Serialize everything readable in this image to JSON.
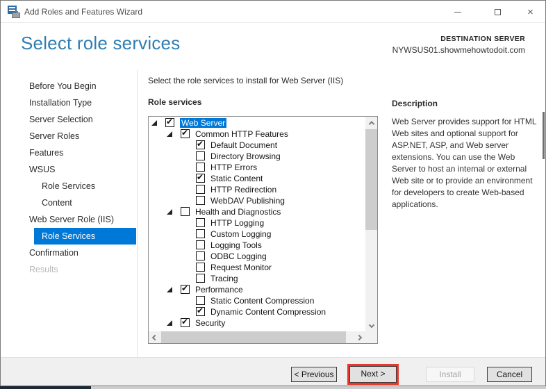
{
  "window": {
    "title": "Add Roles and Features Wizard"
  },
  "header": {
    "title": "Select role services",
    "destination_label": "DESTINATION SERVER",
    "destination_server": "NYWSUS01.showmehowtodoit.com"
  },
  "sidebar": {
    "items": [
      {
        "label": "Before You Begin",
        "indent": 0,
        "state": "normal"
      },
      {
        "label": "Installation Type",
        "indent": 0,
        "state": "normal"
      },
      {
        "label": "Server Selection",
        "indent": 0,
        "state": "normal"
      },
      {
        "label": "Server Roles",
        "indent": 0,
        "state": "normal"
      },
      {
        "label": "Features",
        "indent": 0,
        "state": "normal"
      },
      {
        "label": "WSUS",
        "indent": 0,
        "state": "normal"
      },
      {
        "label": "Role Services",
        "indent": 1,
        "state": "normal"
      },
      {
        "label": "Content",
        "indent": 1,
        "state": "normal"
      },
      {
        "label": "Web Server Role (IIS)",
        "indent": 0,
        "state": "normal"
      },
      {
        "label": "Role Services",
        "indent": 1,
        "state": "selected"
      },
      {
        "label": "Confirmation",
        "indent": 0,
        "state": "normal"
      },
      {
        "label": "Results",
        "indent": 0,
        "state": "disabled"
      }
    ]
  },
  "main": {
    "instruction": "Select the role services to install for Web Server (IIS)",
    "tree_label": "Role services",
    "tree": {
      "items": [
        {
          "label": "Web Server",
          "level": 0,
          "checked": true,
          "expanded": true,
          "selected": true
        },
        {
          "label": "Common HTTP Features",
          "level": 1,
          "checked": true,
          "expanded": true
        },
        {
          "label": "Default Document",
          "level": 2,
          "checked": true
        },
        {
          "label": "Directory Browsing",
          "level": 2,
          "checked": false
        },
        {
          "label": "HTTP Errors",
          "level": 2,
          "checked": false
        },
        {
          "label": "Static Content",
          "level": 2,
          "checked": true
        },
        {
          "label": "HTTP Redirection",
          "level": 2,
          "checked": false
        },
        {
          "label": "WebDAV Publishing",
          "level": 2,
          "checked": false
        },
        {
          "label": "Health and Diagnostics",
          "level": 1,
          "checked": false,
          "expanded": true
        },
        {
          "label": "HTTP Logging",
          "level": 2,
          "checked": false
        },
        {
          "label": "Custom Logging",
          "level": 2,
          "checked": false
        },
        {
          "label": "Logging Tools",
          "level": 2,
          "checked": false
        },
        {
          "label": "ODBC Logging",
          "level": 2,
          "checked": false
        },
        {
          "label": "Request Monitor",
          "level": 2,
          "checked": false
        },
        {
          "label": "Tracing",
          "level": 2,
          "checked": false
        },
        {
          "label": "Performance",
          "level": 1,
          "checked": true,
          "expanded": true
        },
        {
          "label": "Static Content Compression",
          "level": 2,
          "checked": false
        },
        {
          "label": "Dynamic Content Compression",
          "level": 2,
          "checked": true
        },
        {
          "label": "Security",
          "level": 1,
          "checked": true,
          "expanded": true
        }
      ]
    },
    "description": {
      "heading": "Description",
      "body": "Web Server provides support for HTML Web sites and optional support for ASP.NET, ASP, and Web server extensions. You can use the Web Server to host an internal or external Web site or to provide an environment for developers to create Web-based applications."
    }
  },
  "footer": {
    "previous_label": "< Previous",
    "next_label": "Next >",
    "install_label": "Install",
    "cancel_label": "Cancel"
  },
  "colors": {
    "accent_blue": "#0078d7",
    "heading_blue": "#2e7db3",
    "annotation_red": "#e8382c",
    "taskbar_navy": "#1e2936"
  }
}
